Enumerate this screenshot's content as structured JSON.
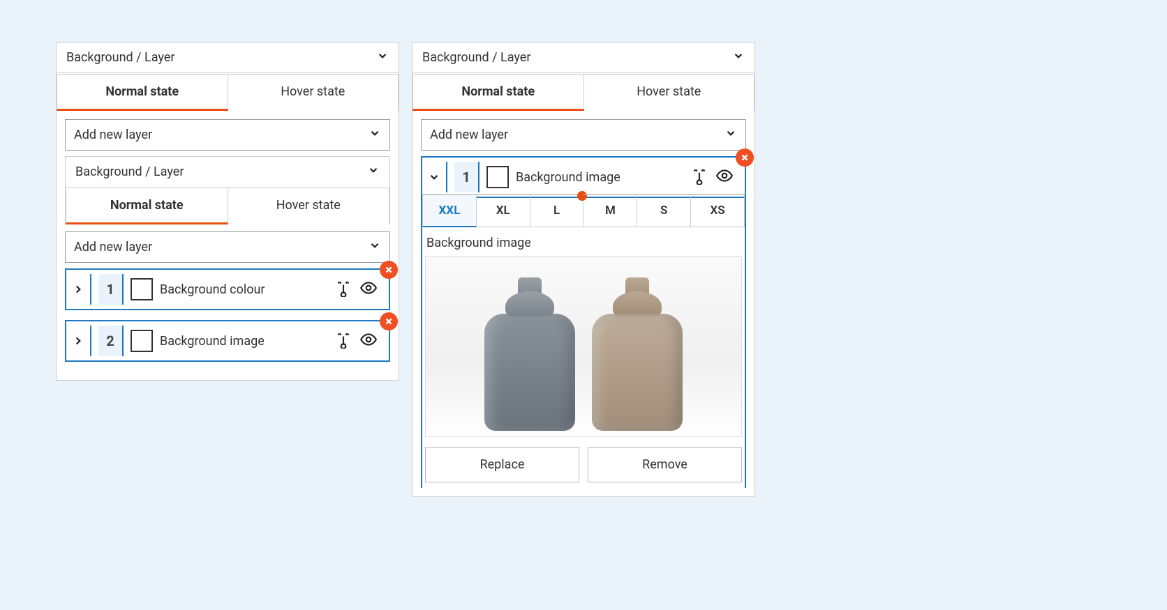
{
  "leftPanel": {
    "header": "Background / Layer",
    "tabs": {
      "normal": "Normal state",
      "hover": "Hover state"
    },
    "addLayer": "Add new layer",
    "nested": {
      "header": "Background / Layer",
      "tabs": {
        "normal": "Normal state",
        "hover": "Hover state"
      },
      "addLayer": "Add new layer",
      "layers": [
        {
          "num": "1",
          "label": "Background colour"
        },
        {
          "num": "2",
          "label": "Background image"
        }
      ]
    }
  },
  "rightPanel": {
    "header": "Background / Layer",
    "tabs": {
      "normal": "Normal state",
      "hover": "Hover state"
    },
    "addLayer": "Add new layer",
    "layer": {
      "num": "1",
      "label": "Background image"
    },
    "sizes": [
      "XXL",
      "XL",
      "L",
      "M",
      "S",
      "XS"
    ],
    "activeSize": "XXL",
    "dotOn": "L",
    "sublabel": "Background image",
    "buttons": {
      "replace": "Replace",
      "remove": "Remove"
    }
  }
}
